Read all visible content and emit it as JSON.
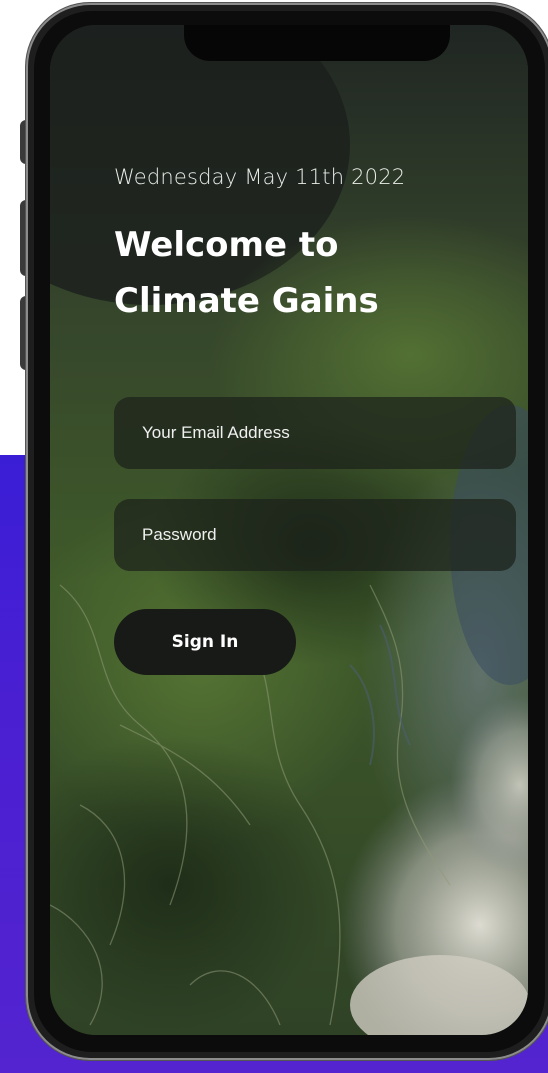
{
  "login": {
    "date": "Wednesday May 11th 2022",
    "title_line1": "Welcome to",
    "title_line2": "Climate Gains",
    "email_placeholder": "Your Email Address",
    "password_placeholder": "Password",
    "signin_label": "Sign In"
  },
  "colors": {
    "background_accent": "#4a1fd2",
    "button_bg": "#171a16",
    "field_bg": "#1c211a",
    "text": "#ffffff"
  }
}
